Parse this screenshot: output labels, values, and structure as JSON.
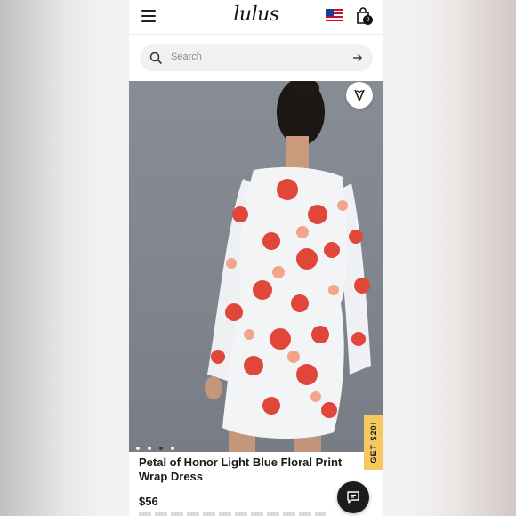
{
  "header": {
    "logo_text": "lulus",
    "menu_icon": "hamburger-icon",
    "flag_icon": "us-flag-icon",
    "bag_icon": "shopping-bag-icon",
    "bag_count": "0"
  },
  "search": {
    "placeholder": "Search",
    "icon": "search-icon",
    "submit_icon": "arrow-right-icon"
  },
  "gallery": {
    "wishlist_icon": "heart-v-icon",
    "slide_count": 4,
    "active_slide": 3
  },
  "promo": {
    "label": "GET $20!"
  },
  "product": {
    "title": "Petal of Honor Light Blue Floral Print Wrap Dress",
    "price": "$56"
  },
  "chat": {
    "icon": "chat-icon"
  }
}
